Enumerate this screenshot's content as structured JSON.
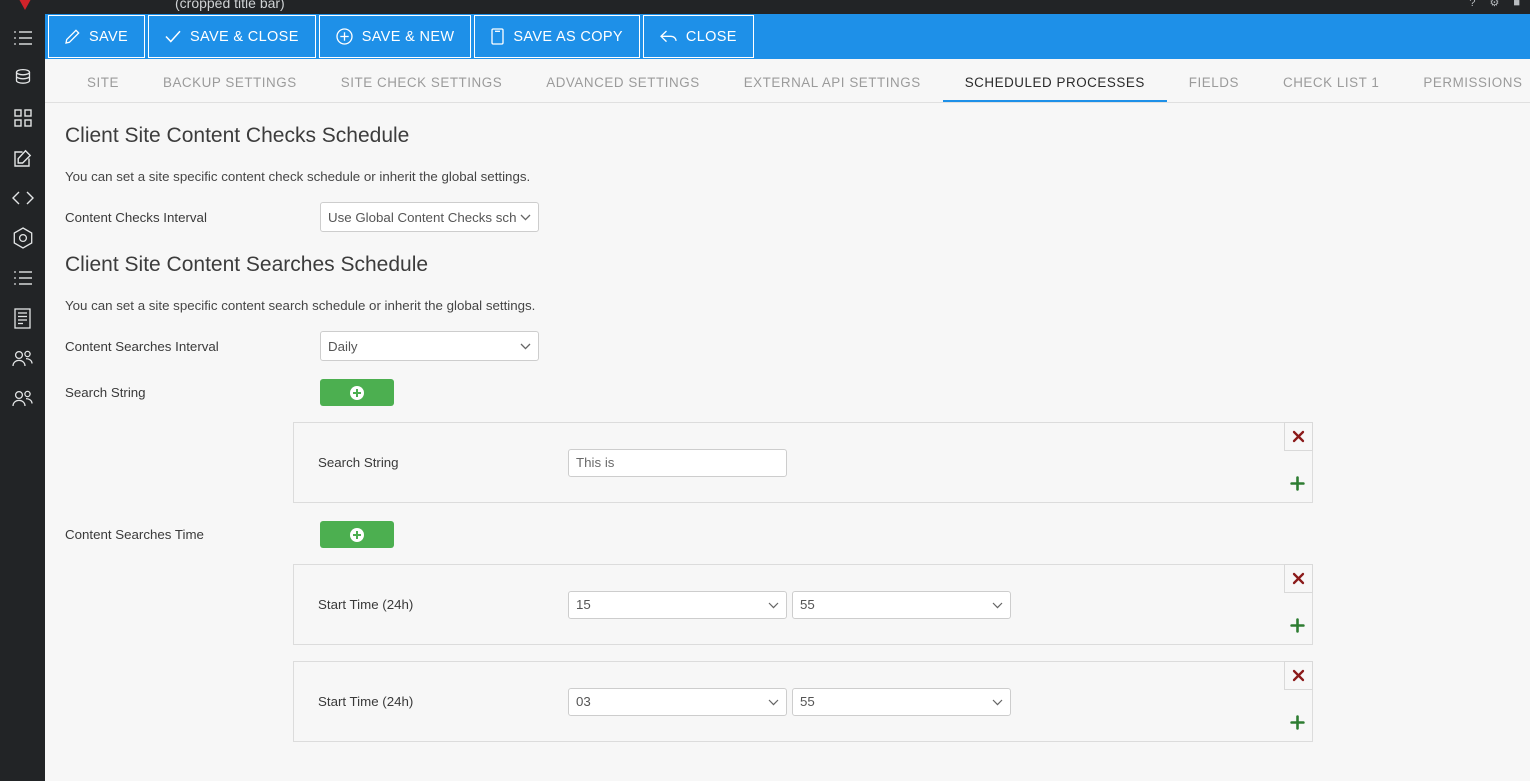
{
  "topbar": {
    "title": "(cropped title bar)",
    "logo_icon": "red-triangle-logo"
  },
  "rail": {
    "items": [
      {
        "icon": "list-icon",
        "name": "sidebar-item-list"
      },
      {
        "icon": "database-icon",
        "name": "sidebar-item-database"
      },
      {
        "icon": "grid-icon",
        "name": "sidebar-item-grid"
      },
      {
        "icon": "edit-icon",
        "name": "sidebar-item-edit"
      },
      {
        "icon": "code-icon",
        "name": "sidebar-item-code"
      },
      {
        "icon": "hexagon-icon",
        "name": "sidebar-item-settings"
      },
      {
        "icon": "list-icon",
        "name": "sidebar-item-list-2"
      },
      {
        "icon": "document-icon",
        "name": "sidebar-item-documents"
      },
      {
        "icon": "users-icon",
        "name": "sidebar-item-users"
      },
      {
        "icon": "users-icon",
        "name": "sidebar-item-users-2"
      }
    ]
  },
  "actionbar": {
    "background": "#1e90e8",
    "buttons": [
      {
        "label": "SAVE",
        "icon": "pencil-icon"
      },
      {
        "label": "SAVE & CLOSE",
        "icon": "check-icon"
      },
      {
        "label": "SAVE & NEW",
        "icon": "plus-circle-icon"
      },
      {
        "label": "SAVE AS COPY",
        "icon": "copy-icon"
      },
      {
        "label": "CLOSE",
        "icon": "back-arrow-icon"
      }
    ]
  },
  "tabs": [
    {
      "label": "SITE",
      "active": false
    },
    {
      "label": "BACKUP SETTINGS",
      "active": false
    },
    {
      "label": "SITE CHECK SETTINGS",
      "active": false
    },
    {
      "label": "ADVANCED SETTINGS",
      "active": false
    },
    {
      "label": "EXTERNAL API SETTINGS",
      "active": false
    },
    {
      "label": "SCHEDULED PROCESSES",
      "active": true
    },
    {
      "label": "FIELDS",
      "active": false
    },
    {
      "label": "CHECK LIST 1",
      "active": false
    },
    {
      "label": "PERMISSIONS",
      "active": false
    }
  ],
  "accent_color": "#1e90e8",
  "add_button_color": "#4caf50",
  "delete_icon_color": "#8b1a1a",
  "content": {
    "checks_section": {
      "title": "Client Site Content Checks Schedule",
      "description": "You can set a site specific content check schedule or inherit the global settings.",
      "interval_label": "Content Checks Interval",
      "interval_value": "Use Global Content Checks schedule"
    },
    "searches_section": {
      "title": "Client Site Content Searches Schedule",
      "description": "You can set a site specific content search schedule or inherit the global settings.",
      "interval_label": "Content Searches Interval",
      "interval_value": "Daily"
    },
    "search_string_group": {
      "label": "Search String",
      "add_button_icon": "plus-circle-icon",
      "rows": [
        {
          "label": "Search String",
          "value": "This is",
          "delete_icon": "x-icon",
          "add_icon": "plus-icon"
        }
      ]
    },
    "searches_time_group": {
      "label": "Content Searches Time",
      "add_button_icon": "plus-circle-icon",
      "rows": [
        {
          "label": "Start Time (24h)",
          "hour": "15",
          "minute": "55",
          "delete_icon": "x-icon",
          "add_icon": "plus-icon"
        },
        {
          "label": "Start Time (24h)",
          "hour": "03",
          "minute": "55",
          "delete_icon": "x-icon",
          "add_icon": "plus-icon"
        }
      ]
    }
  },
  "glyphs": {
    "chevron_down": "⌄",
    "x": "✖",
    "plus": "＋"
  }
}
